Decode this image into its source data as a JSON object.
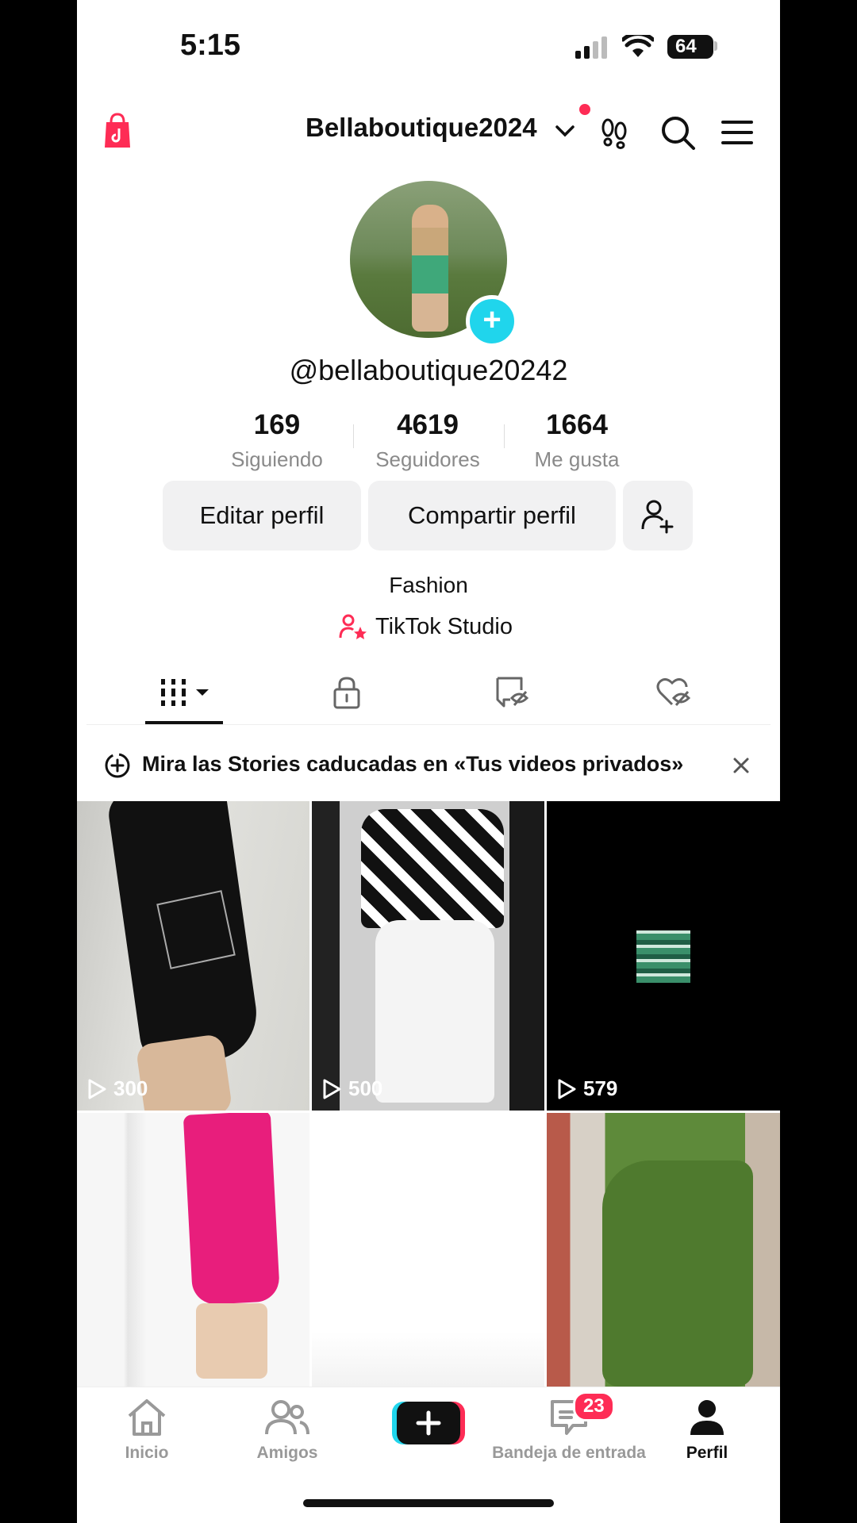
{
  "status_bar": {
    "time": "5:15",
    "battery": "64"
  },
  "header": {
    "title": "Bellaboutique2024"
  },
  "profile": {
    "handle": "@bellaboutique20242",
    "stats": [
      {
        "value": "169",
        "label": "Siguiendo"
      },
      {
        "value": "4619",
        "label": "Seguidores"
      },
      {
        "value": "1664",
        "label": "Me gusta"
      }
    ],
    "buttons": {
      "edit": "Editar perfil",
      "share": "Compartir perfil"
    },
    "bio": "Fashion",
    "studio_link": "TikTok Studio"
  },
  "banner": {
    "text": "Mira las Stories caducadas en «Tus videos privados»"
  },
  "grid": {
    "videos": [
      {
        "views": "300"
      },
      {
        "views": "500"
      },
      {
        "views": "579"
      },
      {
        "views": ""
      },
      {
        "views": ""
      },
      {
        "views": ""
      }
    ]
  },
  "bottom_nav": {
    "items": [
      {
        "label": "Inicio"
      },
      {
        "label": "Amigos"
      },
      {
        "label": ""
      },
      {
        "label": "Bandeja de entrada"
      },
      {
        "label": "Perfil"
      }
    ],
    "inbox_badge": "23"
  },
  "colors": {
    "accent": "#fe2c55",
    "cyan": "#20d5ec",
    "text": "#111111",
    "muted": "#8a8a8a"
  }
}
